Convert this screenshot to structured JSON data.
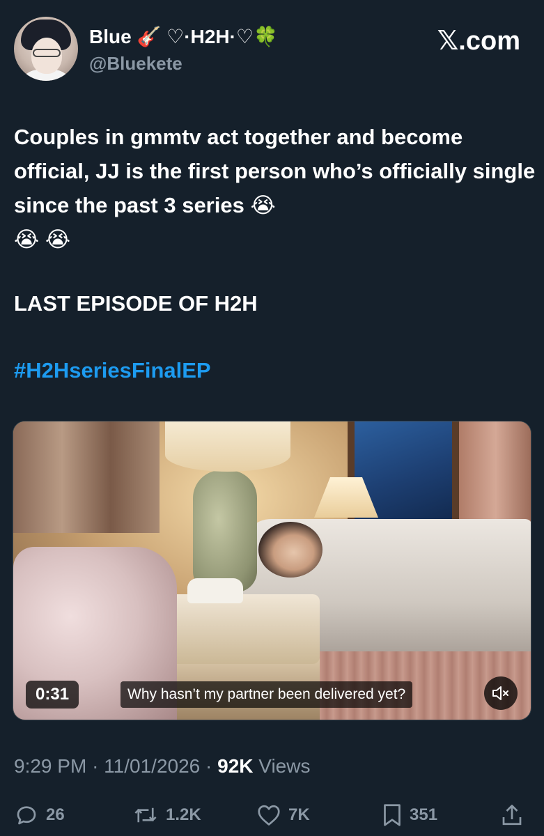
{
  "header": {
    "display_name": "Blue 🎸 ♡·H2H·♡🍀",
    "handle": "@Bluekete",
    "site_logo": "𝕏.com"
  },
  "tweet": {
    "text": "Couples in gmmtv act together and become official, JJ is the first person who’s officially single since the past 3 series 😭\n😭 😭",
    "headline": "LAST EPISODE OF H2H",
    "hashtag": "#H2HseriesFinalEP"
  },
  "video": {
    "duration": "0:31",
    "caption": "Why hasn’t my partner been delivered yet?",
    "mute_icon": "speaker-muted-icon"
  },
  "meta": {
    "time": "9:29 PM",
    "date": "11/01/2026",
    "views_count": "92K",
    "views_label": "Views"
  },
  "actions": {
    "replies": "26",
    "reposts": "1.2K",
    "likes": "7K",
    "bookmarks": "351"
  },
  "colors": {
    "background": "#15202b",
    "hashtag": "#1d9bf0",
    "secondary_text": "#8b98a5"
  }
}
